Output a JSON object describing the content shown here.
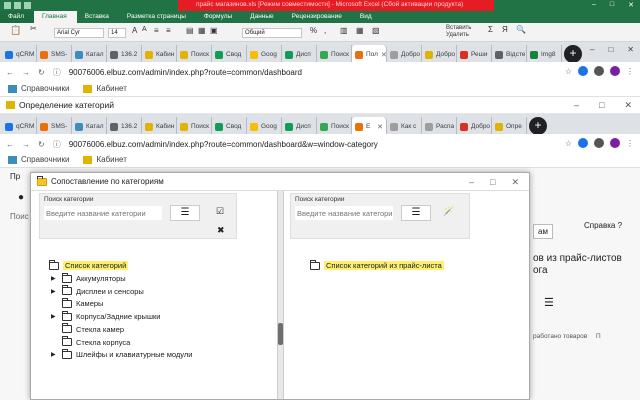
{
  "excel": {
    "title": "прайс магазинов.xls [Режим совместимости] - Microsoft Excel (Сбой активации продукта)",
    "menu": [
      "Файл",
      "Главная",
      "Вставка",
      "Разметка страницы",
      "Формулы",
      "Данные",
      "Рецензирование",
      "Вид"
    ],
    "font_name": "Arial Cyr",
    "font_size": "14",
    "number_format": "Общий",
    "insert_label": "Вставить",
    "delete_label": "Удалить"
  },
  "browser1": {
    "tabs": [
      {
        "label": "qCRM",
        "color": "#1a73e8"
      },
      {
        "label": "SMS-",
        "color": "#e8710a"
      },
      {
        "label": "Катал",
        "color": "#3c8dbc"
      },
      {
        "label": "136.2",
        "color": "#5f6368"
      },
      {
        "label": "Кабин",
        "color": "#e0b400"
      },
      {
        "label": "Поиск",
        "color": "#e0b400"
      },
      {
        "label": "Свод",
        "color": "#0f9d58"
      },
      {
        "label": "Goog",
        "color": "#fbbc04"
      },
      {
        "label": "Дисп",
        "color": "#0f9d58"
      },
      {
        "label": "Поиск",
        "color": "#34a853"
      },
      {
        "label": "Пол",
        "color": "#e8710a",
        "active": true
      },
      {
        "label": "Добро",
        "color": "#9e9e9e"
      },
      {
        "label": "Добро",
        "color": "#e0b400"
      },
      {
        "label": "Реши",
        "color": "#d93025"
      },
      {
        "label": "Відсте",
        "color": "#5f6368"
      },
      {
        "label": "Img8",
        "color": "#188038"
      }
    ],
    "url": "90076006.elbuz.com/admin/index.php?route=common/dashboard"
  },
  "bookmarks": {
    "item1": "Справочники",
    "item2": "Кабинет"
  },
  "inner_window": {
    "title": "Определение категорий"
  },
  "browser2": {
    "tabs": [
      {
        "label": "qCRM",
        "color": "#1a73e8"
      },
      {
        "label": "SMS-",
        "color": "#e8710a"
      },
      {
        "label": "Катал",
        "color": "#3c8dbc"
      },
      {
        "label": "136.2",
        "color": "#5f6368"
      },
      {
        "label": "Кабин",
        "color": "#e0b400"
      },
      {
        "label": "Поиск",
        "color": "#e0b400"
      },
      {
        "label": "Свод",
        "color": "#0f9d58"
      },
      {
        "label": "Goog",
        "color": "#fbbc04"
      },
      {
        "label": "Дисп",
        "color": "#0f9d58"
      },
      {
        "label": "Поиск",
        "color": "#34a853"
      },
      {
        "label": "Е",
        "color": "#e8710a",
        "active": true
      },
      {
        "label": "Как с",
        "color": "#9e9e9e"
      },
      {
        "label": "Распа",
        "color": "#9e9e9e"
      },
      {
        "label": "Добро",
        "color": "#d93025"
      },
      {
        "label": "Опре",
        "color": "#e0b400"
      }
    ],
    "url": "90076006.elbuz.com/admin/index.php?route=common/dashboard&w=window-category"
  },
  "admin": {
    "peek_pr": "Пр",
    "peek_search": "Поис",
    "help": "Справка",
    "heading_line1": "ов из прайс-листов",
    "heading_line2": "ога",
    "processed": "работано товаров",
    "btn_peek": "ам"
  },
  "dialog": {
    "title": "Сопоставление по категориям",
    "left": {
      "search_label": "Поиск категории",
      "search_placeholder": "Введите название категории",
      "root": "Список категорий",
      "items": [
        {
          "label": "Аккумуляторы",
          "expandable": true
        },
        {
          "label": "Дисплеи и сенсоры",
          "expandable": true
        },
        {
          "label": "Камеры",
          "expandable": false
        },
        {
          "label": "Корпуса/Задние крышки",
          "expandable": true
        },
        {
          "label": "Стекла камер",
          "expandable": false
        },
        {
          "label": "Стекла корпуса",
          "expandable": false
        },
        {
          "label": "Шлейфы и клавиатурные модули",
          "expandable": true
        }
      ]
    },
    "right": {
      "search_label": "Поиск категории",
      "search_placeholder": "Введите название категории",
      "root": "Список категорий из прайс-листа"
    }
  },
  "colors": {
    "excel_green": "#217346",
    "highlight": "#ffef6f"
  }
}
